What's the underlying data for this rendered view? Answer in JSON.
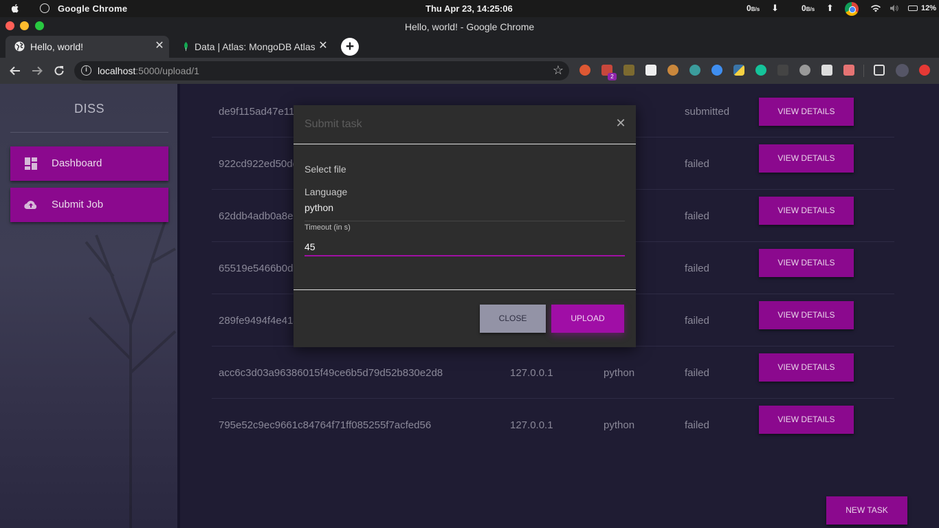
{
  "menubar": {
    "app_name": "Google Chrome",
    "clock": "Thu Apr 23, 14:25:06",
    "net_down": "0",
    "net_down_unit": "B/s",
    "net_up": "0",
    "net_up_unit": "B/s",
    "battery": "12%"
  },
  "window": {
    "title": "Hello, world! - Google Chrome"
  },
  "tabs": [
    {
      "label": "Hello, world!"
    },
    {
      "label": "Data | Atlas: MongoDB Atlas"
    }
  ],
  "omnibox": {
    "host": "localhost",
    "path": ":5000/upload/1"
  },
  "extensions": {
    "badge_count": "2"
  },
  "sidebar": {
    "brand": "DISS",
    "items": [
      {
        "label": "Dashboard",
        "icon": "dashboard-icon"
      },
      {
        "label": "Submit Job",
        "icon": "cloud-upload-icon"
      }
    ]
  },
  "jobs": [
    {
      "id": "de9f115ad47e113",
      "ip": "",
      "language": "",
      "status": "submitted",
      "action": "VIEW DETAILS"
    },
    {
      "id": "922cd922ed50de",
      "ip": "",
      "language": "",
      "status": "failed",
      "action": "VIEW DETAILS"
    },
    {
      "id": "62ddb4adb0a8e8",
      "ip": "",
      "language": "",
      "status": "failed",
      "action": "VIEW DETAILS"
    },
    {
      "id": "65519e5466b0da",
      "ip": "",
      "language": "",
      "status": "failed",
      "action": "VIEW DETAILS"
    },
    {
      "id": "289fe9494f4e414",
      "ip": "",
      "language": "",
      "status": "failed",
      "action": "VIEW DETAILS"
    },
    {
      "id": "acc6c3d03a96386015f49ce6b5d79d52b830e2d8",
      "ip": "127.0.0.1",
      "language": "python",
      "status": "failed",
      "action": "VIEW DETAILS"
    },
    {
      "id": "795e52c9ec9661c84764f71ff085255f7acfed56",
      "ip": "127.0.0.1",
      "language": "python",
      "status": "failed",
      "action": "VIEW DETAILS"
    }
  ],
  "new_task_label": "NEW TASK",
  "modal": {
    "title": "Submit task",
    "select_file_label": "Select file",
    "language_label": "Language",
    "language_value": "python",
    "timeout_label": "Timeout (in s)",
    "timeout_value": "45",
    "close_label": "CLOSE",
    "upload_label": "UPLOAD"
  },
  "colors": {
    "accent": "#8b098e",
    "upload_accent": "#a00ea6",
    "page_bg": "#1f1c33",
    "modal_bg": "#2d2d2d"
  }
}
